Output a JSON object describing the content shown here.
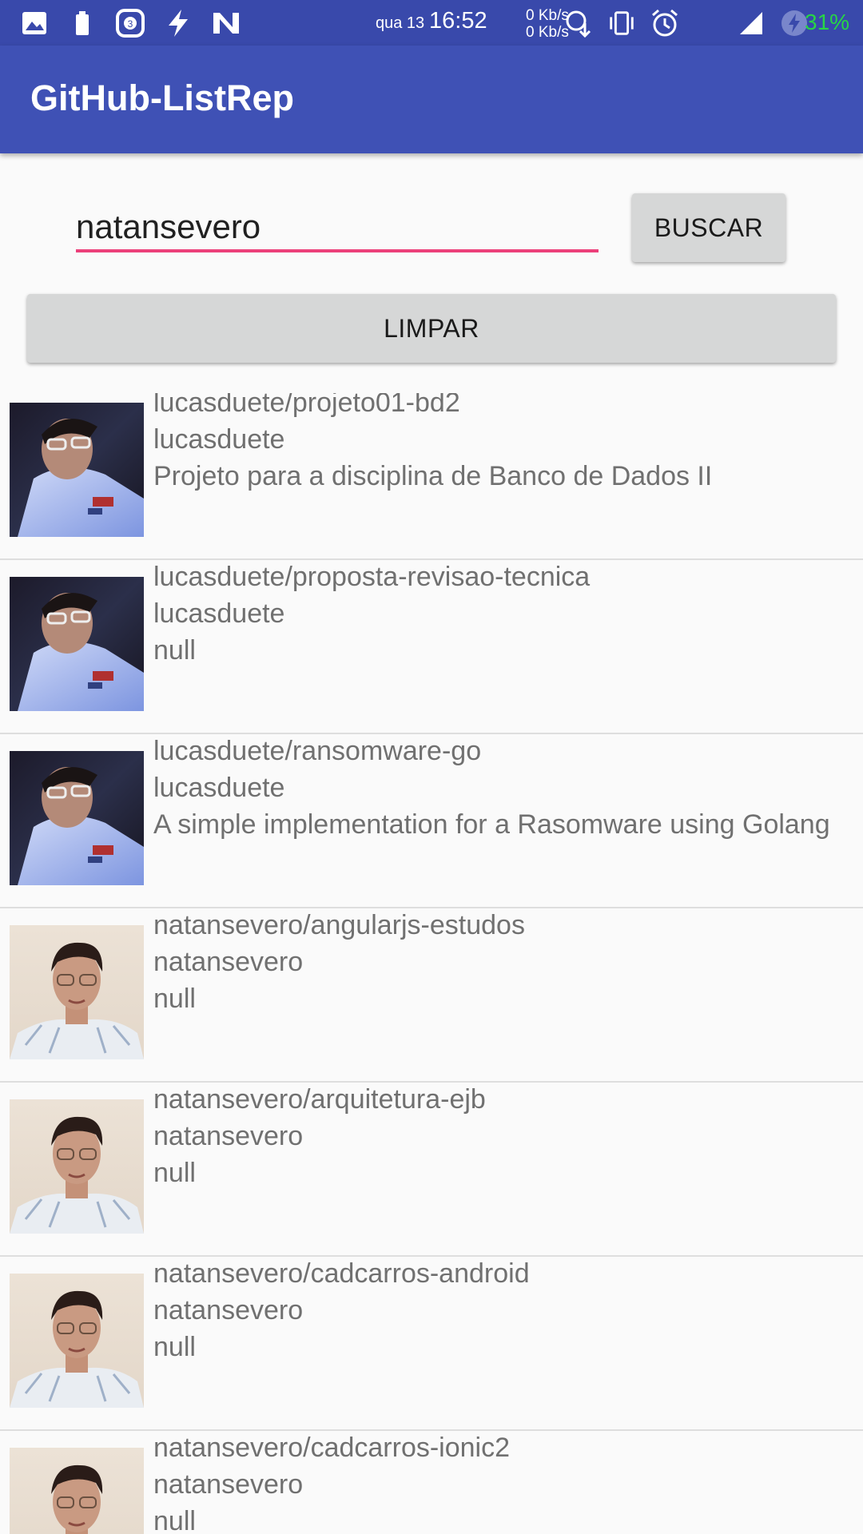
{
  "status_bar": {
    "date": "qua 13",
    "time": "16:52",
    "net_up": "0 Kb/s",
    "net_down": "0 Kb/s",
    "battery_percent": "31%",
    "left_icons": [
      "image-icon",
      "battery-saver-icon",
      "instagram-notification-icon",
      "flash-icon",
      "n-app-icon"
    ],
    "right_icons": [
      "data-sync-icon",
      "vibrate-icon",
      "alarm-icon",
      "wifi-icon",
      "signal-icon",
      "battery-charging-icon"
    ],
    "colors": {
      "background": "#3949ab",
      "battery_text": "#27d645"
    }
  },
  "toolbar": {
    "title": "GitHub-ListRep",
    "color": "#3f51b5"
  },
  "search": {
    "value": "natansevero",
    "underline_color": "#ec407a",
    "search_button_label": "BUSCAR",
    "clear_button_label": "LIMPAR"
  },
  "repos": [
    {
      "name": "lucasduete/projeto01-bd2",
      "owner": "lucasduete",
      "description": "Projeto para a disciplina de Banco de Dados II",
      "avatar": "lucasduete-avatar"
    },
    {
      "name": "lucasduete/proposta-revisao-tecnica",
      "owner": "lucasduete",
      "description": "null",
      "avatar": "lucasduete-avatar"
    },
    {
      "name": "lucasduete/ransomware-go",
      "owner": "lucasduete",
      "description": "A simple implementation for a Rasomware using Golang",
      "avatar": "lucasduete-avatar"
    },
    {
      "name": "natansevero/angularjs-estudos",
      "owner": "natansevero",
      "description": "null",
      "avatar": "natansevero-avatar"
    },
    {
      "name": "natansevero/arquitetura-ejb",
      "owner": "natansevero",
      "description": "null",
      "avatar": "natansevero-avatar"
    },
    {
      "name": "natansevero/cadcarros-android",
      "owner": "natansevero",
      "description": "null",
      "avatar": "natansevero-avatar"
    },
    {
      "name": "natansevero/cadcarros-ionic2",
      "owner": "natansevero",
      "description": "null",
      "avatar": "natansevero-avatar"
    }
  ]
}
